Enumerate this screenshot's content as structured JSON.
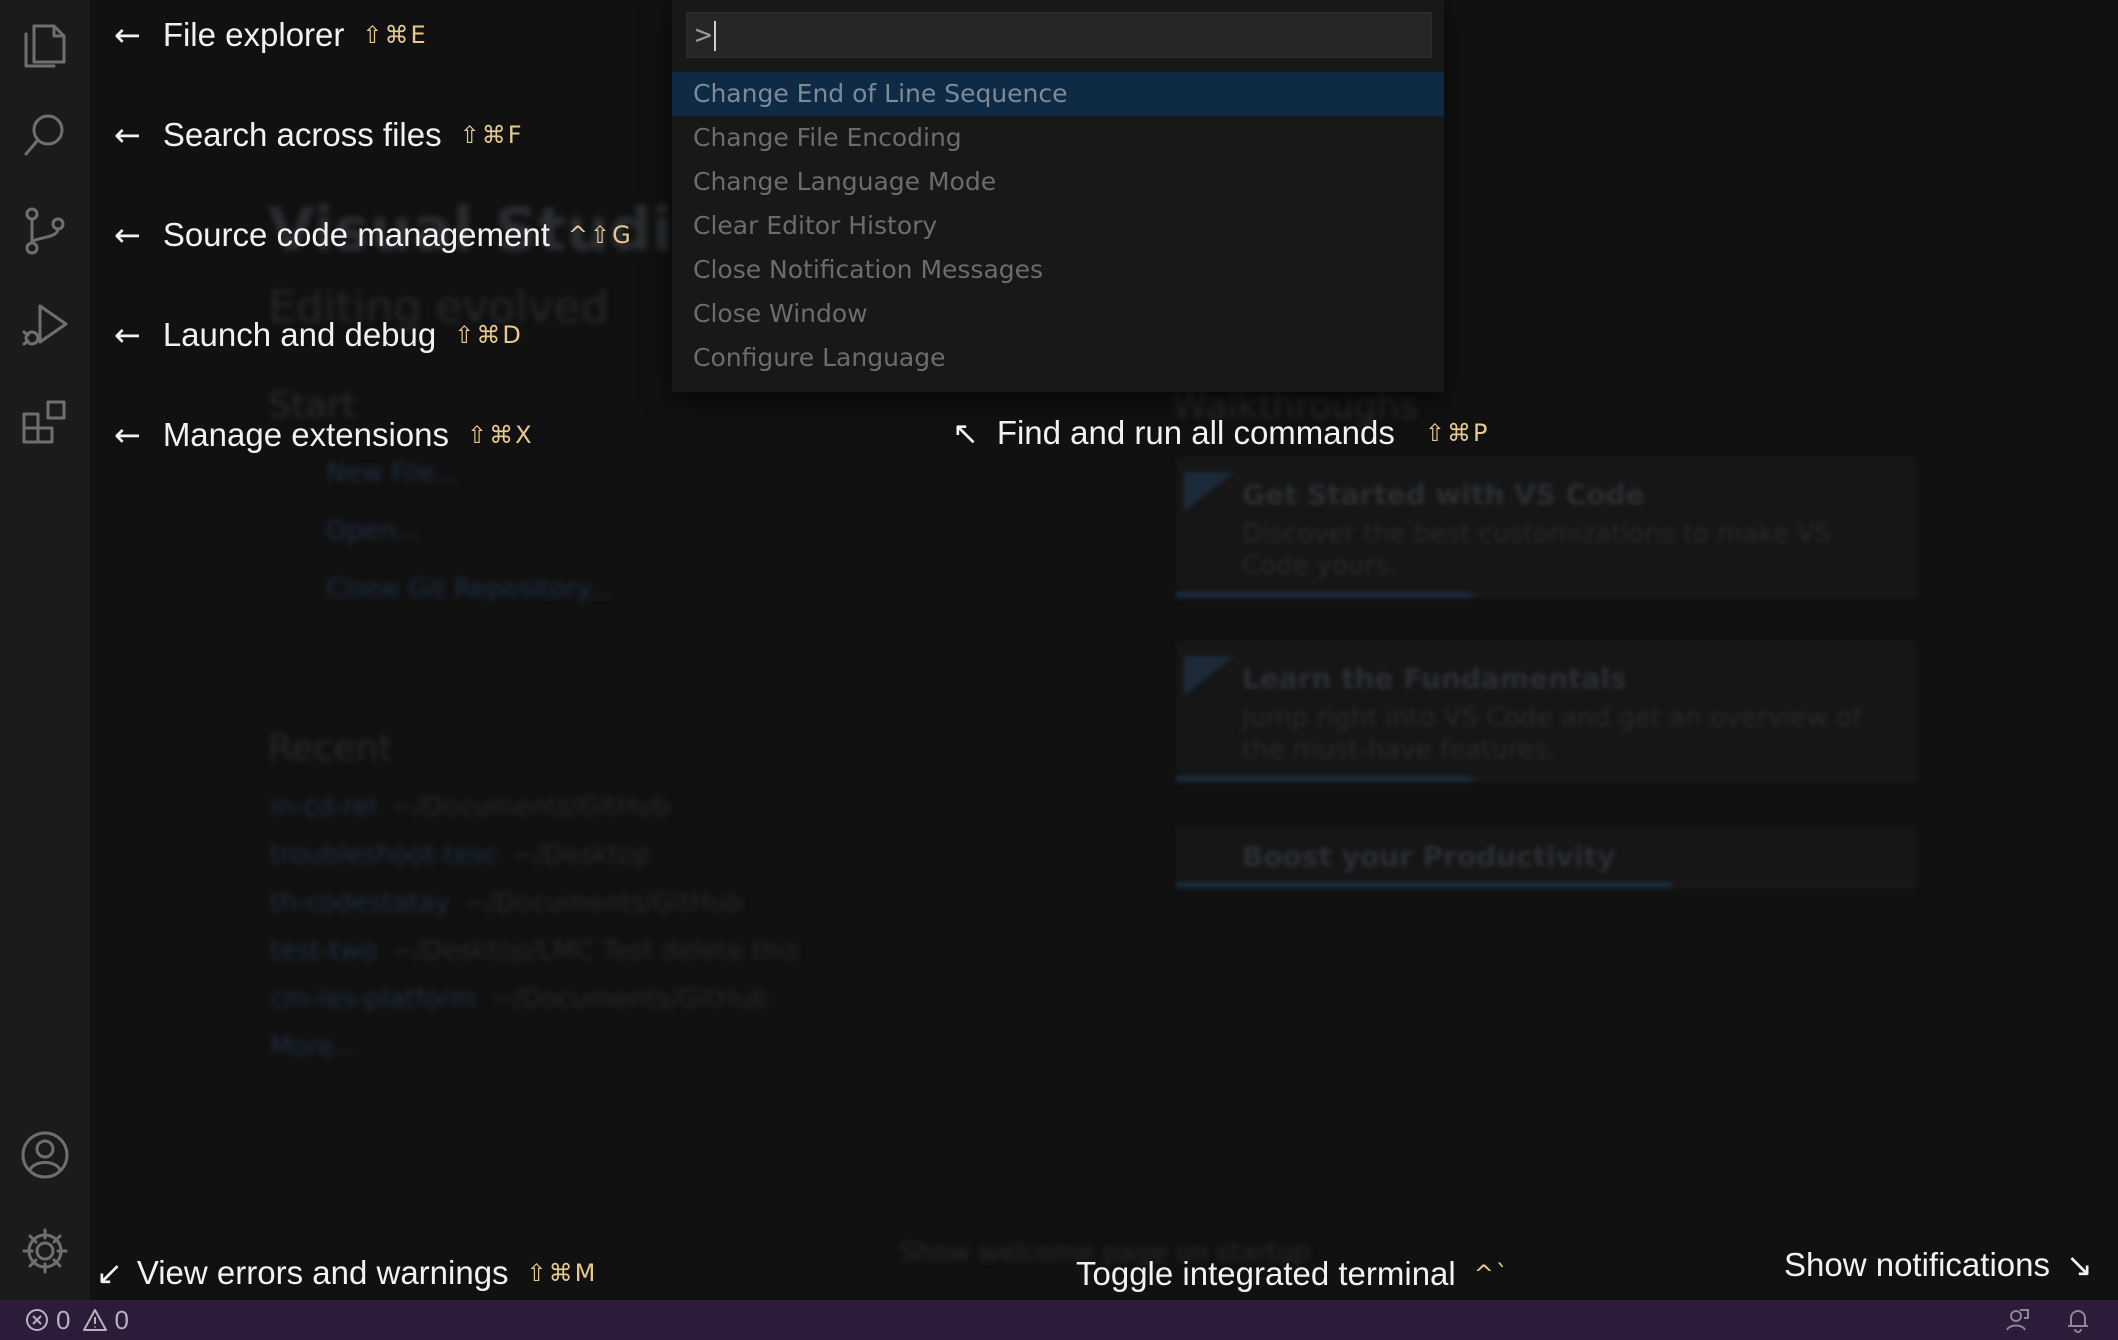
{
  "activity_bar": {
    "items": [
      "explorer",
      "search",
      "source-control",
      "run-and-debug",
      "extensions"
    ],
    "bottom_items": [
      "accounts",
      "manage"
    ]
  },
  "command_palette": {
    "input_value": ">",
    "items": [
      {
        "label": "Change End of Line Sequence",
        "selected": true
      },
      {
        "label": "Change File Encoding",
        "selected": false
      },
      {
        "label": "Change Language Mode",
        "selected": false
      },
      {
        "label": "Clear Editor History",
        "selected": false
      },
      {
        "label": "Close Notification Messages",
        "selected": false
      },
      {
        "label": "Close Window",
        "selected": false
      },
      {
        "label": "Configure Language",
        "selected": false
      }
    ]
  },
  "hints": {
    "file_explorer": {
      "arrow": "←",
      "label": "File explorer",
      "keys": "⇧⌘E"
    },
    "search": {
      "arrow": "←",
      "label": "Search across files",
      "keys": "⇧⌘F"
    },
    "scm": {
      "arrow": "←",
      "label": "Source code management",
      "keys": "^⇧G"
    },
    "debug": {
      "arrow": "←",
      "label": "Launch and debug",
      "keys": "⇧⌘D"
    },
    "extensions": {
      "arrow": "←",
      "label": "Manage extensions",
      "keys": "⇧⌘X"
    },
    "commands": {
      "arrow": "↖",
      "label": "Find and run all commands",
      "keys": "⇧⌘P"
    },
    "problems": {
      "arrow": "↙",
      "label": "View errors and warnings",
      "keys": "⇧⌘M"
    },
    "terminal": {
      "label": "Toggle integrated terminal",
      "keys": "^`"
    },
    "notifications": {
      "label": "Show notifications",
      "arrow": "↘"
    }
  },
  "welcome_background": {
    "title": "Visual Studio",
    "subtitle": "Editing evolved",
    "start_heading": "Start",
    "start_links": [
      "New File...",
      "Open...",
      "Clone Git Repository..."
    ],
    "recent_heading": "Recent",
    "recent": [
      {
        "name": "in-cd-rel",
        "path": "~/Documents/GitHub"
      },
      {
        "name": "troubleshoot-tesc",
        "path": "~/Desktop"
      },
      {
        "name": "th-codestatay",
        "path": "~/Documents/GitHub"
      },
      {
        "name": "test-two",
        "path": "~/Desktop/LMC Test delete this"
      },
      {
        "name": "cm-les-platform",
        "path": "~/Documents/GitHub"
      }
    ],
    "more_label": "More...",
    "walkthroughs_heading": "Walkthroughs",
    "walkthroughs": [
      {
        "title": "Get Started with VS Code",
        "description": "Discover the best customizations to make VS Code yours.",
        "progress": 0.4
      },
      {
        "title": "Learn the Fundamentals",
        "description": "Jump right into VS Code and get an overview of the must-have features.",
        "progress": 0.4
      },
      {
        "title": "Boost your Productivity",
        "description": "",
        "progress": 0.67
      }
    ],
    "show_on_startup": "Show welcome page on startup"
  },
  "status_bar": {
    "errors": "0",
    "warnings": "0",
    "background": "#2d1b3a"
  },
  "colors": {
    "key_hint": "#e7c98f",
    "palette_selected": "#0f2a44"
  }
}
